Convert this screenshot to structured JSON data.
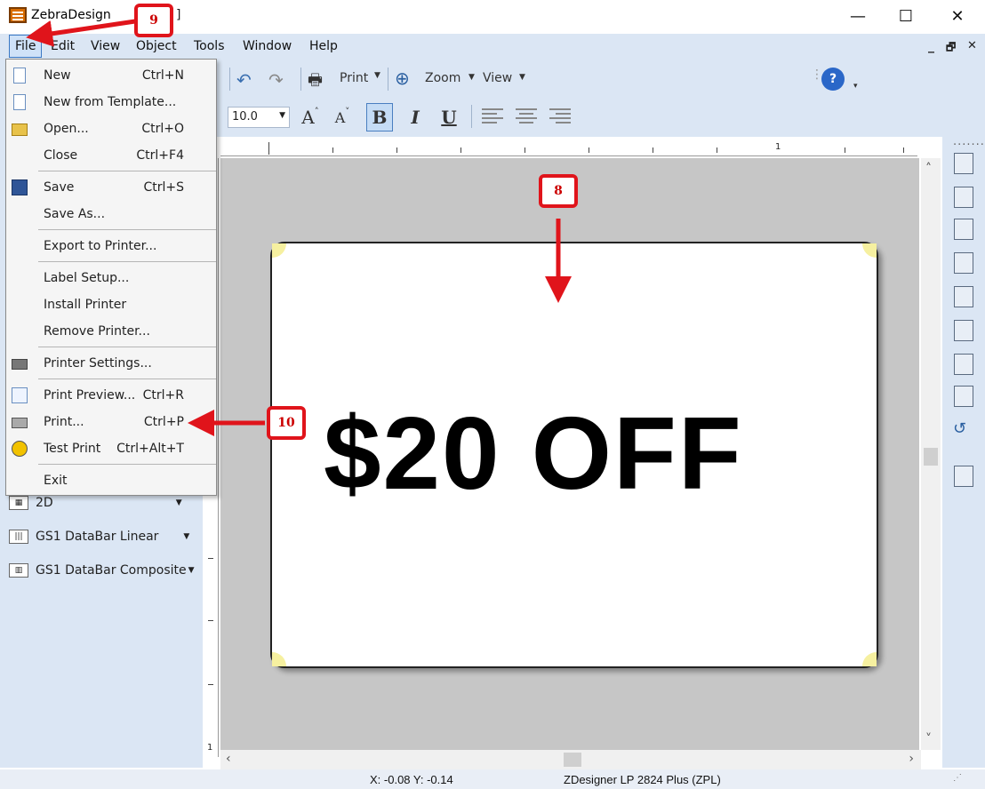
{
  "window": {
    "title": "ZebraDesign",
    "title_tail": "]",
    "minimize": "—",
    "maximize": "☐",
    "close": "✕"
  },
  "menubar": {
    "items": [
      "File",
      "Edit",
      "View",
      "Object",
      "Tools",
      "Window",
      "Help"
    ],
    "mdi_minimize": "_",
    "mdi_restore": "🗗",
    "mdi_close": "✕"
  },
  "toolbar": {
    "print_label": "Print",
    "zoom_label": "Zoom",
    "view_label": "View",
    "font_size": "10.0",
    "bold": "B",
    "italic": "I",
    "underline": "U"
  },
  "file_menu": {
    "items": [
      {
        "label": "New",
        "shortcut": "Ctrl+N",
        "icon": "new-doc-icon"
      },
      {
        "label": "New from Template...",
        "shortcut": "",
        "icon": "template-icon"
      },
      {
        "label": "Open...",
        "shortcut": "Ctrl+O",
        "icon": "open-folder-icon"
      },
      {
        "label": "Close",
        "shortcut": "Ctrl+F4",
        "icon": ""
      },
      {
        "label": "Save",
        "shortcut": "Ctrl+S",
        "icon": "save-icon"
      },
      {
        "label": "Save As...",
        "shortcut": "",
        "icon": ""
      },
      {
        "label": "Export to Printer...",
        "shortcut": "",
        "icon": ""
      },
      {
        "label": "Label Setup...",
        "shortcut": "",
        "icon": ""
      },
      {
        "label": "Install Printer",
        "shortcut": "",
        "icon": ""
      },
      {
        "label": "Remove Printer...",
        "shortcut": "",
        "icon": ""
      },
      {
        "label": "Printer Settings...",
        "shortcut": "",
        "icon": "printer-settings-icon"
      },
      {
        "label": "Print Preview...",
        "shortcut": "Ctrl+R",
        "icon": "print-preview-icon"
      },
      {
        "label": "Print...",
        "shortcut": "Ctrl+P",
        "icon": "printer-icon"
      },
      {
        "label": "Test Print",
        "shortcut": "Ctrl+Alt+T",
        "icon": "test-print-icon"
      },
      {
        "label": "Exit",
        "shortcut": "",
        "icon": ""
      }
    ]
  },
  "left_panel": {
    "items": [
      {
        "label": "2D",
        "icon": "2d-barcode-icon"
      },
      {
        "label": "GS1 DataBar Linear",
        "icon": "gs1-linear-icon"
      },
      {
        "label": "GS1 DataBar Composite",
        "icon": "gs1-composite-icon"
      }
    ]
  },
  "ruler": {
    "label_1": "1",
    "left_1": "1"
  },
  "label": {
    "text": "$20 OFF"
  },
  "statusbar": {
    "coords": "X: -0.08 Y: -0.14",
    "printer": "ZDesigner LP 2824 Plus (ZPL)"
  },
  "callouts": {
    "c8": "8",
    "c9": "9",
    "c10": "10"
  },
  "colors": {
    "accent": "#e0141b",
    "menubar_bg": "#dbe6f4",
    "canvas_bg": "#c6c6c6"
  }
}
